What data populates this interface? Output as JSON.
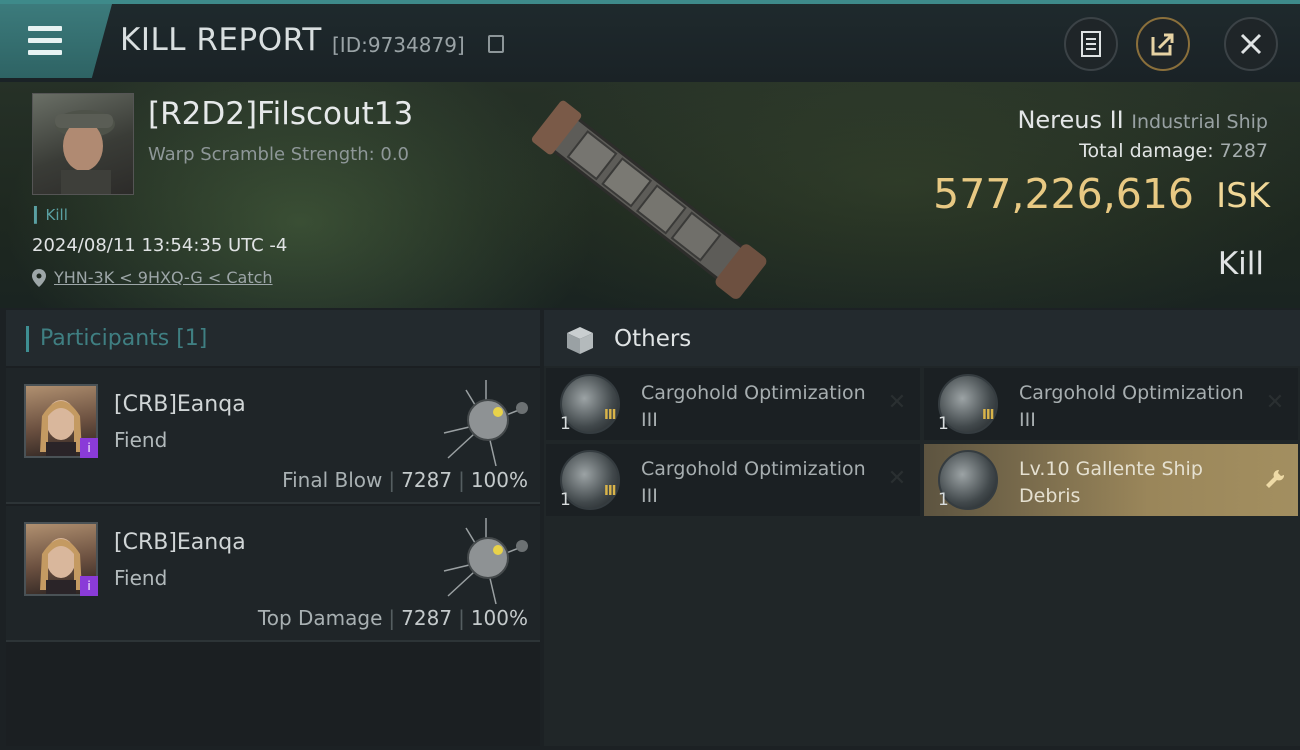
{
  "header": {
    "title": "KILL REPORT",
    "report_id": "[ID:9734879]"
  },
  "victim": {
    "name": "[R2D2]Filscout13",
    "warp_scramble": "Warp Scramble Strength: 0.0",
    "tag": "Kill",
    "time": "2024/08/11 13:54:35 UTC -4",
    "location": "YHN-3K < 9HXQ-G < Catch",
    "ship_name": "Nereus II",
    "ship_class": "Industrial Ship",
    "total_damage_label": "Total damage:",
    "total_damage": "7287",
    "isk_value": "577,226,616",
    "isk_unit": "ISK",
    "kill_type": "Kill"
  },
  "participants": {
    "title": "Participants [1]",
    "rows": [
      {
        "name": "[CRB]Eanqa",
        "ship": "Fiend",
        "badge": "i",
        "label": "Final Blow",
        "damage": "7287",
        "percent": "100%"
      },
      {
        "name": "[CRB]Eanqa",
        "ship": "Fiend",
        "badge": "i",
        "label": "Top Damage",
        "damage": "7287",
        "percent": "100%"
      }
    ]
  },
  "others": {
    "title": "Others",
    "items": [
      {
        "qty": "1",
        "tier": "III",
        "name": "Cargohold Optimization III",
        "action_icon": "close-icon"
      },
      {
        "qty": "1",
        "tier": "III",
        "name": "Cargohold Optimization III",
        "action_icon": "close-icon"
      },
      {
        "qty": "1",
        "tier": "III",
        "name": "Cargohold Optimization III",
        "action_icon": "close-icon"
      },
      {
        "qty": "1",
        "tier": "",
        "name": "Lv.10 Gallente Ship Debris",
        "action_icon": "wrench-icon"
      }
    ]
  },
  "colors": {
    "accent": "#3e8a8a",
    "isk_gold": "#e8c983",
    "highlight": "#a38f60"
  }
}
